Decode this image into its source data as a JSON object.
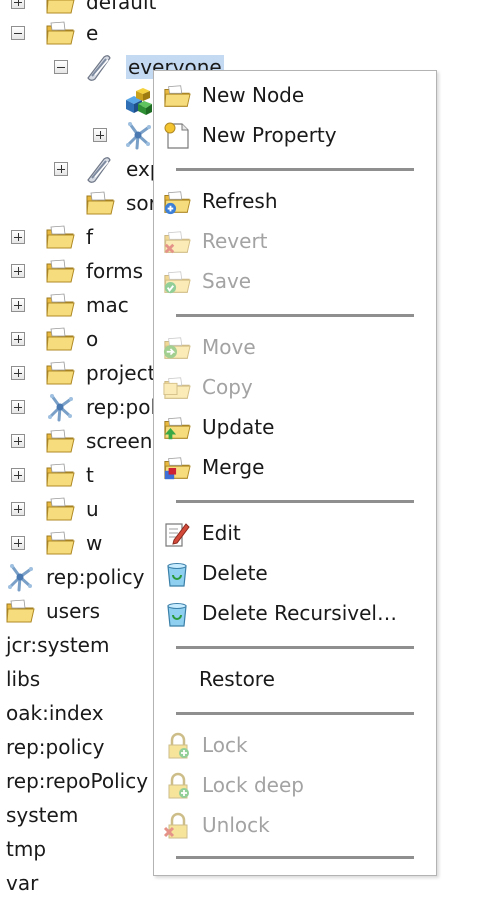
{
  "tree": {
    "rows": [
      {
        "label": "default",
        "expander": "plus",
        "icon": "folder-icon"
      },
      {
        "label": "e",
        "expander": "minus",
        "icon": "folder-icon"
      },
      {
        "label": "everyone",
        "expander": "minus",
        "icon": "group-icon",
        "selected": true
      },
      {
        "label": "",
        "expander": "",
        "icon": "cubes-icon"
      },
      {
        "label": "",
        "expander": "plus",
        "icon": "policy-icon"
      },
      {
        "label": "exp",
        "expander": "plus",
        "icon": "group-icon"
      },
      {
        "label": "sor",
        "expander": "",
        "icon": "folder-icon"
      },
      {
        "label": "f",
        "expander": "plus",
        "icon": "folder-icon"
      },
      {
        "label": "forms",
        "expander": "plus",
        "icon": "folder-icon"
      },
      {
        "label": "mac",
        "expander": "plus",
        "icon": "folder-icon"
      },
      {
        "label": "o",
        "expander": "plus",
        "icon": "folder-icon"
      },
      {
        "label": "project",
        "expander": "plus",
        "icon": "folder-icon"
      },
      {
        "label": "rep:pol",
        "expander": "plus",
        "icon": "policy-icon"
      },
      {
        "label": "screens",
        "expander": "plus",
        "icon": "folder-icon"
      },
      {
        "label": "t",
        "expander": "plus",
        "icon": "folder-icon"
      },
      {
        "label": "u",
        "expander": "plus",
        "icon": "folder-icon"
      },
      {
        "label": "w",
        "expander": "plus",
        "icon": "folder-icon"
      },
      {
        "label": "rep:policy",
        "expander": "",
        "icon": "policy-icon"
      },
      {
        "label": "users",
        "expander": "",
        "icon": "folder-icon"
      },
      {
        "label": "jcr:system",
        "expander": "",
        "icon": ""
      },
      {
        "label": "libs",
        "expander": "",
        "icon": ""
      },
      {
        "label": "oak:index",
        "expander": "",
        "icon": ""
      },
      {
        "label": "rep:policy",
        "expander": "",
        "icon": ""
      },
      {
        "label": "rep:repoPolicy",
        "expander": "",
        "icon": ""
      },
      {
        "label": "system",
        "expander": "",
        "icon": ""
      },
      {
        "label": "tmp",
        "expander": "",
        "icon": ""
      },
      {
        "label": "var",
        "expander": "",
        "icon": ""
      }
    ]
  },
  "context_menu": {
    "items": [
      {
        "label": "New Node",
        "icon": "new-node-icon",
        "disabled": false
      },
      {
        "label": "New Property",
        "icon": "new-property-icon",
        "disabled": false
      },
      {
        "separator": true
      },
      {
        "label": "Refresh",
        "icon": "refresh-icon",
        "disabled": false
      },
      {
        "label": "Revert",
        "icon": "revert-icon",
        "disabled": true
      },
      {
        "label": "Save",
        "icon": "save-icon",
        "disabled": true
      },
      {
        "separator": true
      },
      {
        "label": "Move",
        "icon": "move-icon",
        "disabled": true
      },
      {
        "label": "Copy",
        "icon": "copy-icon",
        "disabled": true
      },
      {
        "label": "Update",
        "icon": "update-icon",
        "disabled": false
      },
      {
        "label": "Merge",
        "icon": "merge-icon",
        "disabled": false
      },
      {
        "separator": true
      },
      {
        "label": "Edit",
        "icon": "edit-icon",
        "disabled": false
      },
      {
        "label": "Delete",
        "icon": "delete-icon",
        "disabled": false
      },
      {
        "label": "Delete Recursivel…",
        "icon": "delete-recursive-icon",
        "disabled": false
      },
      {
        "separator": true
      },
      {
        "label": "Restore",
        "icon": "",
        "disabled": false
      },
      {
        "separator": true
      },
      {
        "label": "Lock",
        "icon": "lock-icon",
        "disabled": true
      },
      {
        "label": "Lock deep",
        "icon": "lock-deep-icon",
        "disabled": true
      },
      {
        "label": "Unlock",
        "icon": "unlock-icon",
        "disabled": true
      },
      {
        "separator": true
      }
    ]
  },
  "colors": {
    "selection": "#c4daf2",
    "folder": "#f2cc5a",
    "disabled_text": "#a3a3a3"
  }
}
